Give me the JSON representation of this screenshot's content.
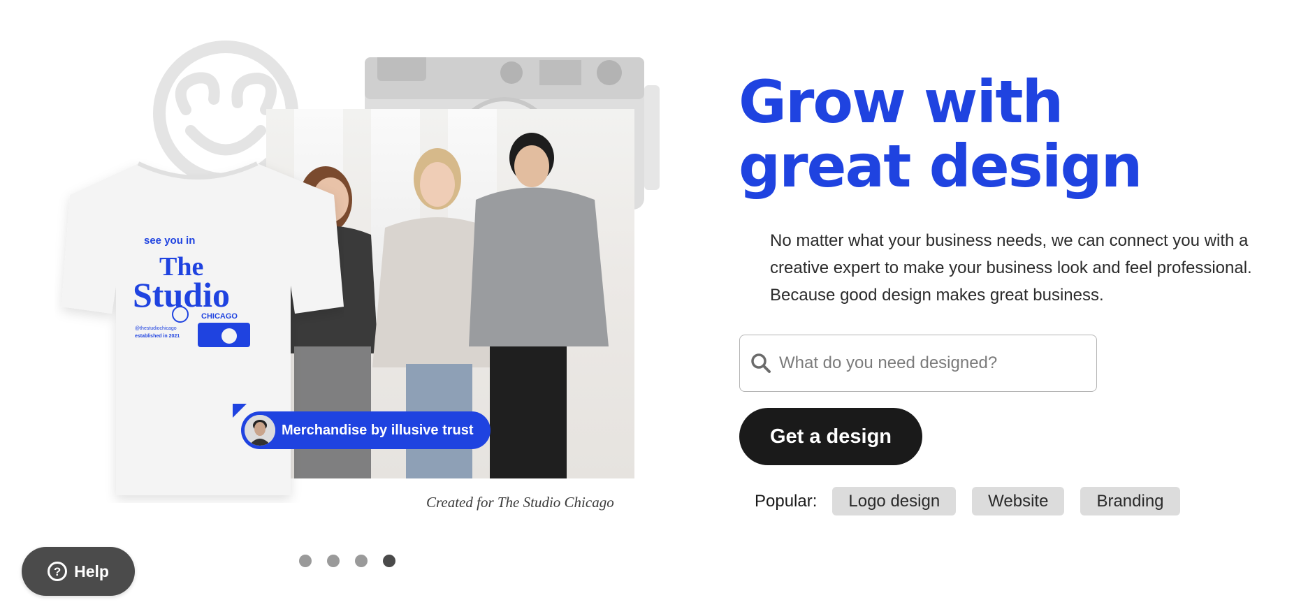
{
  "hero": {
    "tshirt_print": {
      "line1": "see   you   in",
      "brand_the": "The",
      "brand_studio": "Studio",
      "brand_city": "CHICAGO",
      "handle": "@thestudiochicago",
      "established": "established in 2021"
    },
    "merch_badge": "Merchandise by illusive trust",
    "caption": "Created for The Studio Chicago",
    "carousel": {
      "total": 4,
      "active_index": 3
    }
  },
  "help": {
    "label": "Help",
    "icon": "question-circle-icon"
  },
  "main": {
    "headline": "Grow with great design",
    "subcopy": "No matter what your business needs, we can connect you with a creative expert to make your business look and feel professional. Because good design makes great business.",
    "search": {
      "placeholder": "What do you need designed?",
      "value": "",
      "icon": "search-icon"
    },
    "cta": "Get a design",
    "popular": {
      "label": "Popular:",
      "tags": [
        "Logo design",
        "Website",
        "Branding"
      ]
    }
  },
  "colors": {
    "brand_blue": "#1f43e0",
    "cta_bg": "#1a1a1a",
    "chip_bg": "#dcdcdc",
    "help_bg": "#4b4b4b"
  }
}
